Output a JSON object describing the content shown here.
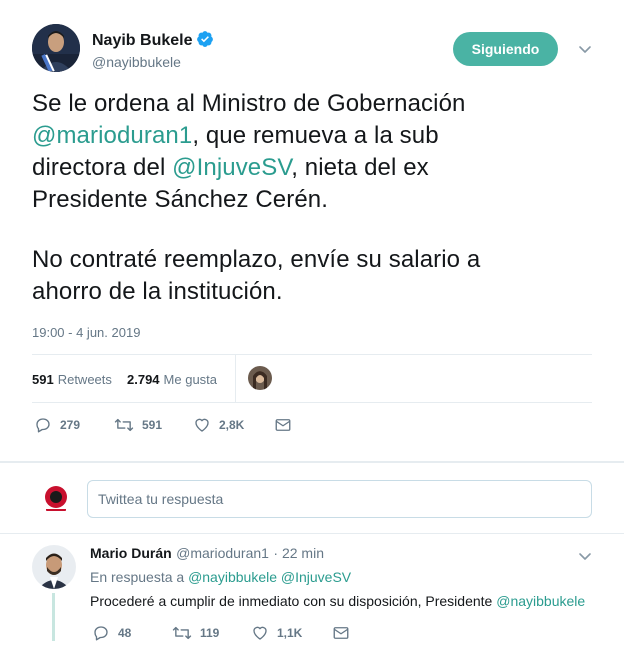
{
  "tweet": {
    "author_name": "Nayib Bukele",
    "author_handle": "@nayibbukele",
    "follow_label": "Siguiendo",
    "lines1": [
      {
        "pre": "Se le ordena al Ministro de Gobernación",
        "link": "",
        "post": ""
      },
      {
        "pre": "",
        "link": "@marioduran1",
        "post": ", que remueva a la sub"
      },
      {
        "pre": "directora del ",
        "link": "@InjuveSV",
        "post": ", nieta del ex"
      },
      {
        "pre": "Presidente Sánchez Cerén.",
        "link": "",
        "post": ""
      }
    ],
    "lines2": [
      "No contraté reemplazo, envíe su salario a",
      "ahorro de la institución."
    ],
    "timestamp": "19:00 - 4 jun. 2019",
    "retweets_count": "591",
    "retweets_label": "Retweets",
    "likes_count": "2.794",
    "likes_label": "Me gusta",
    "actions": {
      "replies": "279",
      "retweets": "591",
      "likes": "2,8K"
    }
  },
  "reply_box": {
    "placeholder": "Twittea tu respuesta"
  },
  "reply": {
    "author_name": "Mario Durán",
    "author_handle": "@marioduran1",
    "time": "· 22 min",
    "in_reply_prefix": "En respuesta a",
    "in_reply_links": "@nayibbukele @InjuveSV",
    "text": "Procederé a cumplir de inmediato con su disposición, Presidente",
    "text_link": "@nayibbukele",
    "actions": {
      "replies": "48",
      "retweets": "119",
      "likes": "1,1K"
    }
  },
  "colors": {
    "accent": "#2b9c8f",
    "follow_bg": "#4ab3a4",
    "verified": "#1da1f2",
    "muted": "#657786"
  }
}
